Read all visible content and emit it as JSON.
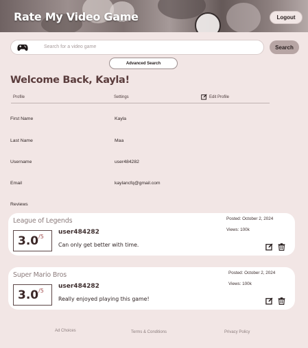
{
  "header": {
    "site_title": "Rate My Video Game",
    "logout_label": "Logout"
  },
  "search": {
    "placeholder": "Search for a video game",
    "button_label": "Search",
    "advanced_label": "Advanced Search",
    "icon": "gamepad-icon"
  },
  "welcome": "Welcome Back, Kayla!",
  "tabs": {
    "profile": "Profile",
    "settings": "Settings",
    "edit": "Edit Profile",
    "edit_icon": "edit-icon"
  },
  "profile": {
    "first_name_label": "First Name",
    "first_name": "Kayla",
    "last_name_label": "Last Name",
    "last_name": "Maa",
    "username_label": "Username",
    "username": "user484282",
    "email_label": "Email",
    "email": "kaylancfq@gmail.com"
  },
  "reviews_label": "Reviews",
  "reviews": [
    {
      "game": "League of Legends",
      "score": "3.0",
      "score_max": "/5",
      "user": "user484282",
      "text": "Can only get better with time.",
      "posted": "Posted: October 2, 2024",
      "views": "Views: 100k"
    },
    {
      "game": "Super Mario Bros",
      "score": "3.0",
      "score_max": "/5",
      "user": "user484282",
      "text": "Really enjoyed playing this game!",
      "posted": "Posted: October 2, 2024",
      "views": "Views: 100k"
    }
  ],
  "footer": {
    "ad_choices": "Ad Choices",
    "terms": "Terms & Conditions",
    "privacy": "Privacy Policy"
  },
  "colors": {
    "background": "#f2e6e5",
    "accent": "#b7a5a4",
    "title_text": "#5a3c3c"
  }
}
